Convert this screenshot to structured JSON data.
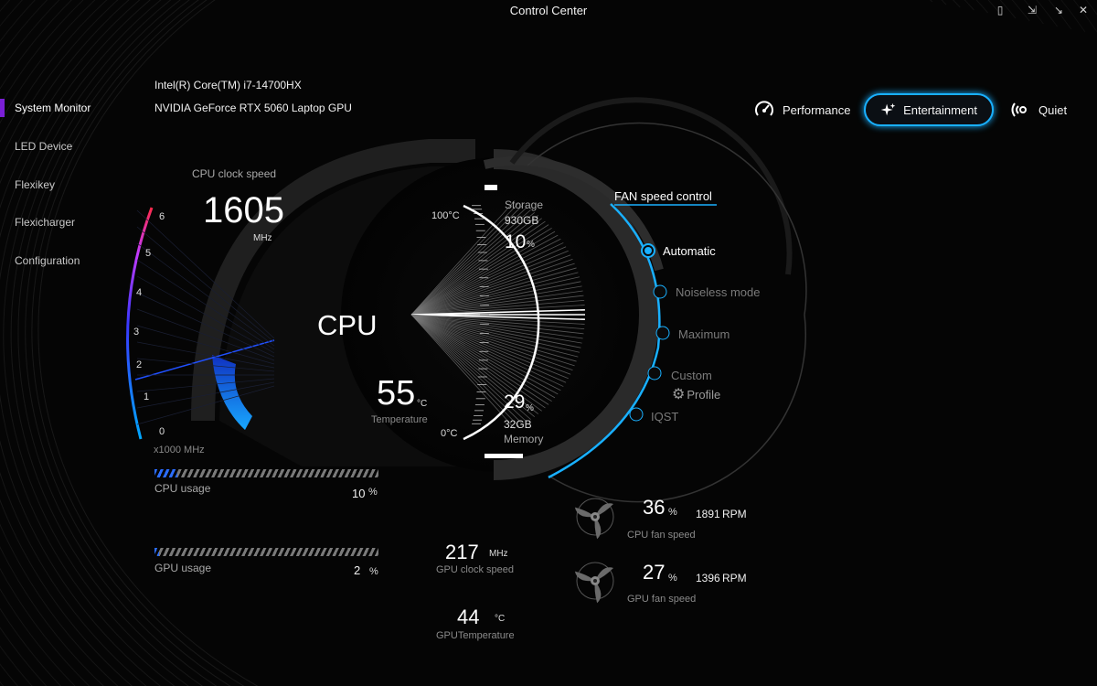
{
  "window": {
    "title": "Control Center",
    "buttons": [
      "help-icon",
      "restore-icon",
      "minimize-icon",
      "close-icon"
    ]
  },
  "sidebar": {
    "items": [
      {
        "label": "System Monitor",
        "active": true
      },
      {
        "label": "LED Device"
      },
      {
        "label": "Flexikey"
      },
      {
        "label": "Flexicharger"
      },
      {
        "label": "Configuration"
      }
    ]
  },
  "hardware": {
    "cpu_name": "Intel(R) Core(TM) i7-14700HX",
    "gpu_name": "NVIDIA GeForce RTX 5060 Laptop GPU"
  },
  "modes": {
    "items": [
      {
        "label": "Performance",
        "icon": "speedometer-icon"
      },
      {
        "label": "Entertainment",
        "icon": "sparkle-icon",
        "active": true
      },
      {
        "label": "Quiet",
        "icon": "quiet-waves-icon"
      }
    ]
  },
  "cpu_gauge": {
    "clock_label": "CPU clock speed",
    "clock_value": "1605",
    "clock_unit": "MHz",
    "clock_fraction": 0.2675,
    "scale_unit": "x1000 MHz",
    "scale_ticks": [
      "0",
      "1",
      "2",
      "3",
      "4",
      "5",
      "6"
    ],
    "center_label": "CPU",
    "temp_value": "55",
    "temp_unit": "°C",
    "temp_label": "Temperature",
    "temp_max": "100°C",
    "temp_min": "0°C",
    "temp_fraction": 0.55
  },
  "storage": {
    "label": "Storage",
    "size": "930GB",
    "value": "10",
    "unit": "%",
    "fraction": 0.1
  },
  "memory": {
    "value": "29",
    "unit": "%",
    "size": "32GB",
    "label": "Memory",
    "fraction": 0.29
  },
  "fan_control": {
    "title": "FAN speed control",
    "options": [
      {
        "label": "Automatic",
        "active": true
      },
      {
        "label": "Noiseless mode"
      },
      {
        "label": "Maximum"
      },
      {
        "label": "Custom"
      },
      {
        "label": "IQST"
      }
    ],
    "profile_label": "Profile"
  },
  "cpu_usage": {
    "label": "CPU usage",
    "value": "10",
    "unit": "%",
    "fraction": 0.1
  },
  "gpu_usage": {
    "label": "GPU usage",
    "value": "2",
    "unit": "%",
    "fraction": 0.02
  },
  "gpu_clock": {
    "value": "217",
    "unit": "MHz",
    "label": "GPU clock speed"
  },
  "gpu_temp": {
    "value": "44",
    "unit": "°C",
    "label": "GPUTemperature"
  },
  "cpu_fan": {
    "value": "36",
    "unit": "%",
    "rpm": "1891",
    "rpm_unit": "RPM",
    "label": "CPU fan speed"
  },
  "gpu_fan": {
    "value": "27",
    "unit": "%",
    "rpm": "1396",
    "rpm_unit": "RPM",
    "label": "GPU fan speed"
  },
  "colors": {
    "accent": "#19b0ff",
    "nav_indicator": "#7a1fd6",
    "usage_fill": "#2b6dff"
  }
}
